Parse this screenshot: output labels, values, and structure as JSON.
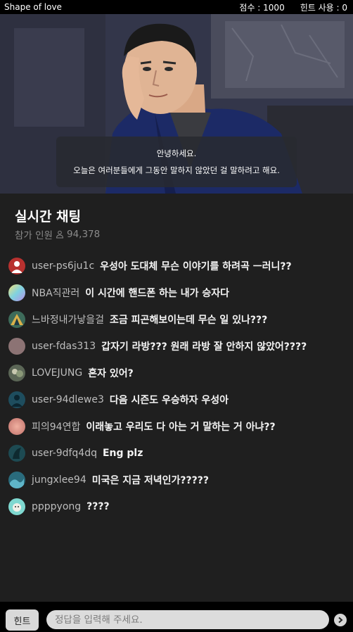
{
  "app": {
    "title": "Shape of love",
    "score_text": "점수 : 1000",
    "hint_usage_text": "힌트 사용 : 0"
  },
  "hero": {
    "image_icon": "character-illustration",
    "subtitle_line1": "안녕하세요.",
    "subtitle_line2": "오늘은 여러분들에게 그동안 말하지 않았던 걸 말하려고 해요."
  },
  "chat": {
    "title": "실시간 채팅",
    "participants_label": "참가 인원",
    "participants_icon": "person-icon",
    "participants_count": "94,378",
    "messages": [
      {
        "user": "user-ps6ju1c",
        "text": "우성아 도대체 무슨 이야기를 하려곡 ㅡ러니??",
        "avatar_color": "#b8312f"
      },
      {
        "user": "NBA직관러",
        "text": "이 시간에 핸드폰 하는 내가 승자다",
        "avatar_color": "#9fd6c8"
      },
      {
        "user": "느바정내가낳을걸",
        "text": "조금 피곤해보이는데 무슨 일 있나???",
        "avatar_color": "#3d6b5a"
      },
      {
        "user": "user-fdas313",
        "text": "갑자기 라방??? 원래 라방 잘 안하지 않았어????",
        "avatar_color": "#8c7374"
      },
      {
        "user": "LOVEJUNG",
        "text": "혼자 있어?",
        "avatar_color": "#5b6656"
      },
      {
        "user": "user-94dlewe3",
        "text": "다음 시즌도 우승하자 우성아",
        "avatar_color": "#1e4d5e"
      },
      {
        "user": "피의94연합",
        "text": "이래놓고 우리도 다 아는 거 말하는 거 아냐??",
        "avatar_color": "#d68e7c"
      },
      {
        "user": "user-9dfq4dq",
        "text": "Eng plz",
        "avatar_color": "#1d4a52"
      },
      {
        "user": "jungxlee94",
        "text": "미국은 지금 저녁인가?????",
        "avatar_color": "#2a6b7c"
      },
      {
        "user": "ppppyong",
        "text": "????",
        "avatar_color": "#7fd8d0"
      }
    ]
  },
  "input": {
    "hint_label": "힌트",
    "placeholder": "정답을 입력해 주세요.",
    "send_icon": "chevron-right-icon"
  }
}
